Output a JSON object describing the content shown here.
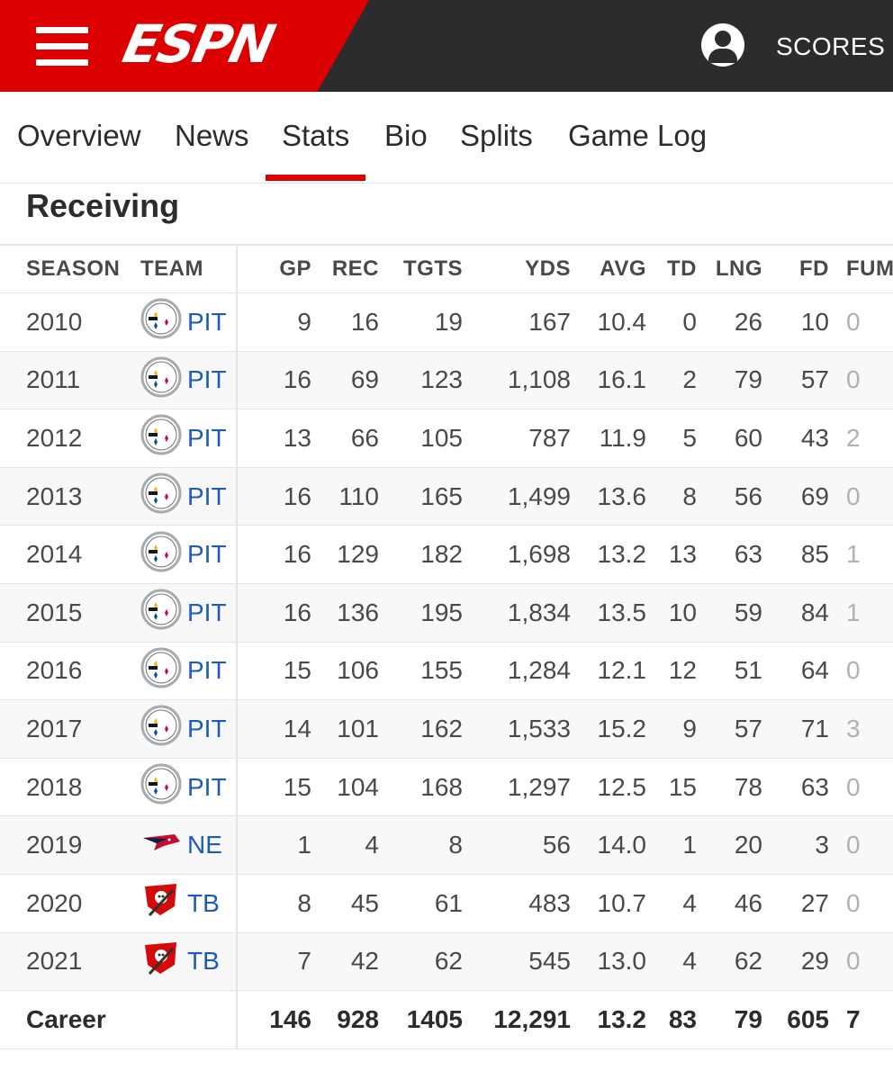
{
  "header": {
    "logo_text": "ESPN",
    "scores_label": "SCORES",
    "colors": {
      "brand_red": "#dd0000",
      "header_dark": "#2b2c2d",
      "link_blue": "#1d5cb4"
    }
  },
  "tabs": [
    {
      "label": "Overview",
      "active": false
    },
    {
      "label": "News",
      "active": false
    },
    {
      "label": "Stats",
      "active": true
    },
    {
      "label": "Bio",
      "active": false
    },
    {
      "label": "Splits",
      "active": false
    },
    {
      "label": "Game Log",
      "active": false
    }
  ],
  "section_title": "Receiving",
  "table": {
    "columns": [
      "SEASON",
      "TEAM",
      "GP",
      "REC",
      "TGTS",
      "YDS",
      "AVG",
      "TD",
      "LNG",
      "FD",
      "FUM"
    ],
    "fum_note": "FUM column is clipped at the right edge of the screenshot; only the leading character of each cell is visible and these values are unverified.",
    "rows": [
      {
        "season": "2010",
        "team": "PIT",
        "logo": "steelers-logo",
        "gp": "9",
        "rec": "16",
        "tgts": "19",
        "yds": "167",
        "avg": "10.4",
        "td": "0",
        "lng": "26",
        "fd": "10",
        "fum": "0"
      },
      {
        "season": "2011",
        "team": "PIT",
        "logo": "steelers-logo",
        "gp": "16",
        "rec": "69",
        "tgts": "123",
        "yds": "1,108",
        "avg": "16.1",
        "td": "2",
        "lng": "79",
        "fd": "57",
        "fum": "0"
      },
      {
        "season": "2012",
        "team": "PIT",
        "logo": "steelers-logo",
        "gp": "13",
        "rec": "66",
        "tgts": "105",
        "yds": "787",
        "avg": "11.9",
        "td": "5",
        "lng": "60",
        "fd": "43",
        "fum": "2"
      },
      {
        "season": "2013",
        "team": "PIT",
        "logo": "steelers-logo",
        "gp": "16",
        "rec": "110",
        "tgts": "165",
        "yds": "1,499",
        "avg": "13.6",
        "td": "8",
        "lng": "56",
        "fd": "69",
        "fum": "0"
      },
      {
        "season": "2014",
        "team": "PIT",
        "logo": "steelers-logo",
        "gp": "16",
        "rec": "129",
        "tgts": "182",
        "yds": "1,698",
        "avg": "13.2",
        "td": "13",
        "lng": "63",
        "fd": "85",
        "fum": "1"
      },
      {
        "season": "2015",
        "team": "PIT",
        "logo": "steelers-logo",
        "gp": "16",
        "rec": "136",
        "tgts": "195",
        "yds": "1,834",
        "avg": "13.5",
        "td": "10",
        "lng": "59",
        "fd": "84",
        "fum": "1"
      },
      {
        "season": "2016",
        "team": "PIT",
        "logo": "steelers-logo",
        "gp": "15",
        "rec": "106",
        "tgts": "155",
        "yds": "1,284",
        "avg": "12.1",
        "td": "12",
        "lng": "51",
        "fd": "64",
        "fum": "0"
      },
      {
        "season": "2017",
        "team": "PIT",
        "logo": "steelers-logo",
        "gp": "14",
        "rec": "101",
        "tgts": "162",
        "yds": "1,533",
        "avg": "15.2",
        "td": "9",
        "lng": "57",
        "fd": "71",
        "fum": "3"
      },
      {
        "season": "2018",
        "team": "PIT",
        "logo": "steelers-logo",
        "gp": "15",
        "rec": "104",
        "tgts": "168",
        "yds": "1,297",
        "avg": "12.5",
        "td": "15",
        "lng": "78",
        "fd": "63",
        "fum": "0"
      },
      {
        "season": "2019",
        "team": "NE",
        "logo": "patriots-logo",
        "gp": "1",
        "rec": "4",
        "tgts": "8",
        "yds": "56",
        "avg": "14.0",
        "td": "1",
        "lng": "20",
        "fd": "3",
        "fum": "0"
      },
      {
        "season": "2020",
        "team": "TB",
        "logo": "buccaneers-logo",
        "gp": "8",
        "rec": "45",
        "tgts": "61",
        "yds": "483",
        "avg": "10.7",
        "td": "4",
        "lng": "46",
        "fd": "27",
        "fum": "0"
      },
      {
        "season": "2021",
        "team": "TB",
        "logo": "buccaneers-logo",
        "gp": "7",
        "rec": "42",
        "tgts": "62",
        "yds": "545",
        "avg": "13.0",
        "td": "4",
        "lng": "62",
        "fd": "29",
        "fum": "0"
      }
    ],
    "career": {
      "label": "Career",
      "gp": "146",
      "rec": "928",
      "tgts": "1405",
      "yds": "12,291",
      "avg": "13.2",
      "td": "83",
      "lng": "79",
      "fd": "605",
      "fum": "7"
    }
  }
}
